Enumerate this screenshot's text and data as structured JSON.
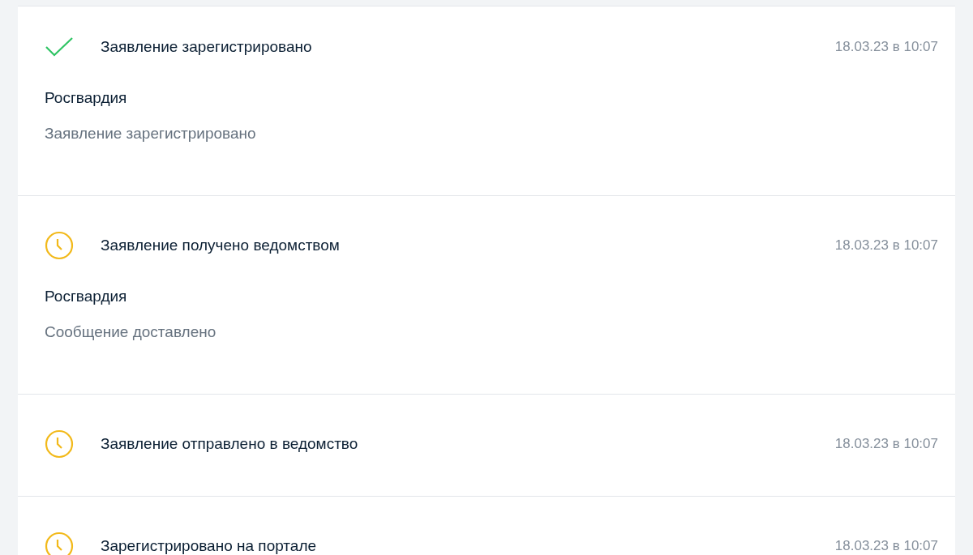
{
  "history": [
    {
      "kind": "done",
      "title": "Заявление зарегистрировано",
      "date": "18.03.23 в 10:07",
      "department": "Росгвардия",
      "message": "Заявление зарегистрировано"
    },
    {
      "kind": "pending",
      "title": "Заявление получено ведомством",
      "date": "18.03.23 в 10:07",
      "department": "Росгвардия",
      "message": "Сообщение доставлено"
    },
    {
      "kind": "pending",
      "title": "Заявление отправлено в ведомство",
      "date": "18.03.23 в 10:07"
    },
    {
      "kind": "pending",
      "title": "Зарегистрировано на портале",
      "date": "18.03.23 в 10:07"
    }
  ]
}
